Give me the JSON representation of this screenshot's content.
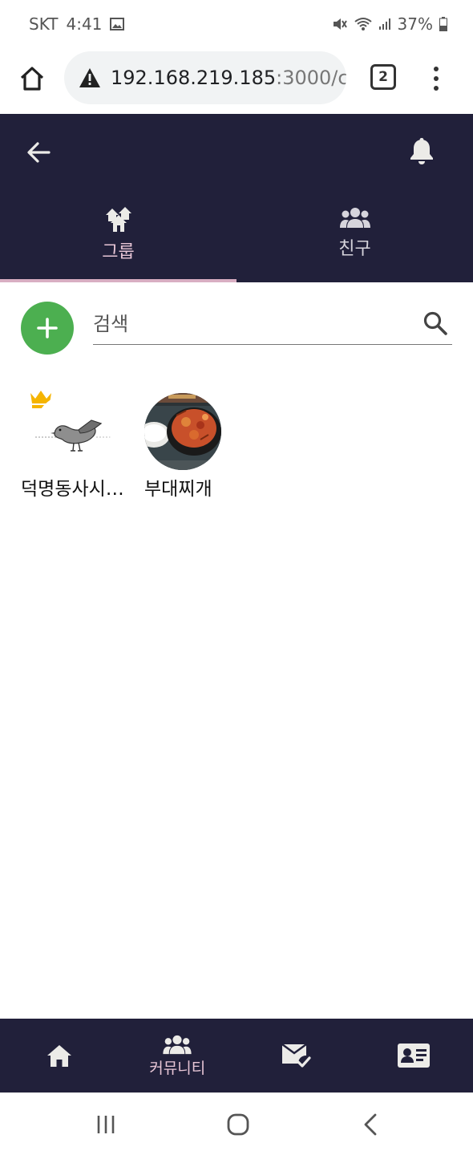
{
  "status_bar": {
    "carrier": "SKT",
    "time": "4:41",
    "battery": "37%"
  },
  "browser": {
    "url_main": "192.168.219.185",
    "url_rest": ":3000/c",
    "tab_count": "2"
  },
  "header": {
    "tabs": [
      {
        "label": "그룹",
        "icon": "group-houses-icon",
        "active": true
      },
      {
        "label": "친구",
        "icon": "people-icon",
        "active": false
      }
    ]
  },
  "search": {
    "placeholder": "검색"
  },
  "groups": [
    {
      "name": "덕명동사시…",
      "is_owner": true,
      "thumbnail": "pigeon-drawing"
    },
    {
      "name": "부대찌개",
      "is_owner": false,
      "thumbnail": "stew-photo"
    }
  ],
  "bottom_nav": {
    "items": [
      {
        "icon": "home-icon",
        "label": ""
      },
      {
        "icon": "community-icon",
        "label": "커뮤니티"
      },
      {
        "icon": "mail-check-icon",
        "label": ""
      },
      {
        "icon": "id-card-icon",
        "label": ""
      }
    ]
  },
  "colors": {
    "header_bg": "#21203a",
    "active_tab": "#e8c6d6",
    "add_button": "#4caf50",
    "crown": "#f5b400"
  }
}
